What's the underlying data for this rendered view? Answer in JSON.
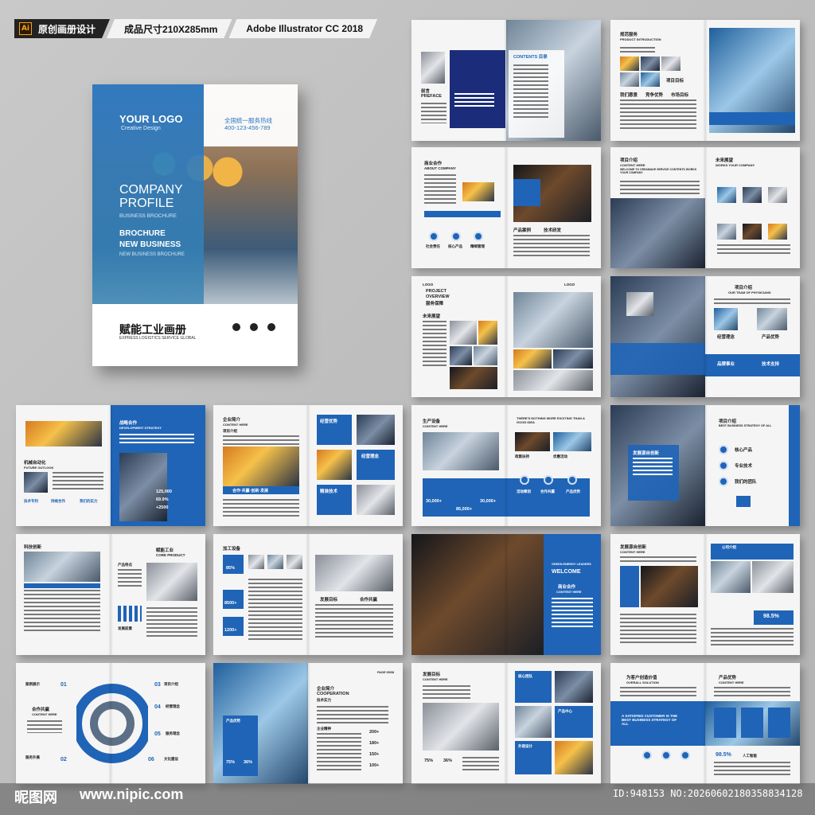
{
  "topbar": {
    "ai_icon": "Ai",
    "tag1": "原创画册设计",
    "tag2": "成品尺寸210X285mm",
    "tag3": "Adobe Illustrator CC 2018"
  },
  "cover": {
    "logo": "YOUR LOGO",
    "logo_sub": "Creative Design",
    "hotline": "全国统一服务热线",
    "tel": "400-123-456-789",
    "company_line1": "COMPANY",
    "company_line2": "PROFILE",
    "business_brochure": "BUSINESS BROCHURE",
    "brochure": "BROCHURE",
    "new_business": "NEW BUSINESS",
    "new_business_sub": "NEW BUSINESS BROCHURE",
    "title": "赋能工业画册",
    "subtitle": "EXPRESS LOGISTICS SERVICE GLOBAL"
  },
  "spreads": {
    "s1": {
      "preface": "前言",
      "preface_en": "PREFACE",
      "contents": "CONTENTS 目录"
    },
    "s2": {
      "title": "规范服务",
      "sub": "PRODUCT INTRODUCTION",
      "l1": "项目目标",
      "l2": "我们愿景",
      "l3": "竞争优势",
      "l4": "市场目标"
    },
    "s3": {
      "title": "商业合作",
      "sub": "ABOUT COMPANY",
      "l1": "产品案例",
      "l2": "技术研发",
      "c1": "社会责任",
      "c2": "核心产品",
      "c3": "精细管理"
    },
    "s4": {
      "title": "项目介绍",
      "sub": "CONTENT HERE",
      "welcome": "WELCOME TO CREAMAKE SERVICE CONTENTS WORKS YOUR COMPANY",
      "right_title": "未来展望",
      "right_sub": "WORKS YOUR COMPANY"
    },
    "s5": {
      "logo1": "LOGO",
      "logo2": "LOGO",
      "title1": "PROJECT",
      "title2": "OVERVIEW",
      "title3": "服务保障",
      "side": "未来展望"
    },
    "s6": {
      "title": "项目介绍",
      "sub": "OUR TEAM OF PHYSICIANS",
      "l1": "经营理念",
      "l2": "产品优势",
      "l3": "品牌事业",
      "l4": "技术支持"
    },
    "s7": {
      "title": "战略合作",
      "sub": "DEVELOPMENT STRATEGY",
      "left": "机械自动化",
      "left_sub": "FUTURE OUTLOOK",
      "n1": "125,000",
      "n2": "69.9%",
      "n3": "+2500",
      "t1": "技术专利",
      "t2": "持续合作",
      "t3": "我们的实力"
    },
    "s8": {
      "title": "企业简介",
      "sub": "CONTENT HERE",
      "l1": "项目介绍",
      "l2": "合作·共赢·创新·发展",
      "r1": "经营优势",
      "r2": "经营理念",
      "r3": "精准技术"
    },
    "s9": {
      "title": "生产设备",
      "sub": "CONTENT HERE",
      "header": "THERE'S NOTHING MORE EXCITING THAN A GOOD IDEA",
      "l1": "政策扶持",
      "l2": "优惠活动",
      "n1": "30,000+",
      "n2": "85,000+",
      "n3": "30,000+",
      "r1": "活动筹划",
      "r2": "合作共赢",
      "r3": "产品优势"
    },
    "s10": {
      "title": "项目介绍",
      "sub": "BEST BUSINESS STRATEGY OF ALL",
      "box": "发展源自创新",
      "l1": "核心产品",
      "l2": "专业技术",
      "l3": "我们的团队"
    },
    "s11": {
      "title": "科技创新",
      "right_title": "赋能工业",
      "right_sub": "CORE PRODUCT",
      "l1": "产品特点",
      "l2": "发展前景"
    },
    "s12": {
      "title": "加工设备",
      "n1": "85%",
      "n2": "8500+",
      "n3": "1200+",
      "l1": "发展目标",
      "l2": "合作共赢"
    },
    "s13": {
      "tag": "GREEN ENERGY LEADERS",
      "welcome": "WELCOME",
      "title": "商业合作",
      "sub": "CONTENT HERE"
    },
    "s14": {
      "title": "发展源自创新",
      "sub": "CONTENT HERE",
      "right": "公司介绍",
      "pct": "98.5%"
    },
    "s15": {
      "l1": "案例展示",
      "l2": "合作共赢",
      "l2_sub": "CONTENT HERE",
      "l3": "服务外展",
      "n1": "01",
      "n2": "02",
      "n3": "03",
      "n4": "04",
      "n5": "05",
      "n6": "06",
      "r1": "项目介绍",
      "r2": "经营理念",
      "r3": "服务理念",
      "r4": "文化建设"
    },
    "s16": {
      "page": "PAGE 05/08",
      "title": "企业简介",
      "sub": "COOPERATION",
      "sub2": "技术实力",
      "l1": "产品优势",
      "n1": "75%",
      "n2": "36%",
      "r1": "企业精神",
      "r2": "200+",
      "r3": "180+",
      "r4": "150+",
      "r5": "100+"
    },
    "s17": {
      "title": "发展目标",
      "sub": "CONTENT HERE",
      "n1": "75%",
      "n2": "36%",
      "r1": "核心团队",
      "r2": "产品中心",
      "r3": "外观设计"
    },
    "s18": {
      "title": "为客户创造价值",
      "sub": "OVERALL SOLUTION",
      "right": "产品优势",
      "right_sub": "CONTENT HERE",
      "banner": "A SATISFIED CUSTOMER IS THE BEST BUSINESS STRATEGY OF ALL",
      "pct": "98.5%",
      "pct_label": "人工智能"
    }
  },
  "footer": {
    "watermark": "昵图网",
    "url": "www.nipic.com",
    "id": "ID:948153 NO:20260602180358834128"
  }
}
